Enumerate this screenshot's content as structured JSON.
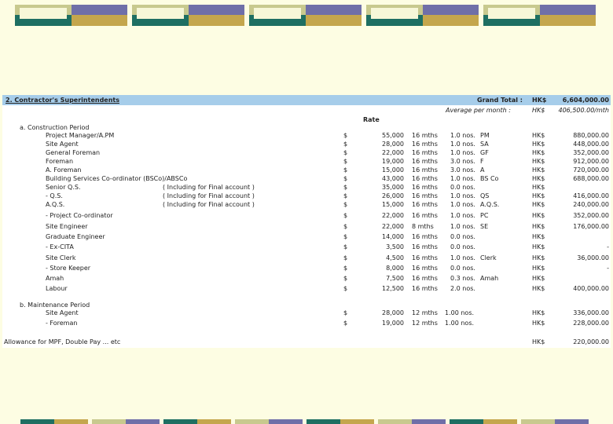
{
  "header_tiles": 5,
  "footer_bars": 8,
  "colors": {
    "tile_top_left": "#c8c98e",
    "tile_top_right": "#6f6fa8",
    "tile_bottom_left": "#1e6f62",
    "tile_bottom_right": "#c4a64d",
    "header_band": "#a6cdea",
    "page_bg": "#fdfde3"
  },
  "section": {
    "title": "2.  Contractor's Superintendents",
    "grand_total_label": "Grand Total :",
    "grand_total_currency": "HK$",
    "grand_total_value": "6,604,000.00",
    "avg_label": "Average per month :",
    "avg_currency": "HK$",
    "avg_value": "406,500.00/mth",
    "rate_header": "Rate"
  },
  "groups": {
    "construction": "a.  Construction Period",
    "maintenance": "b.  Maintenance Period"
  },
  "rows": [
    {
      "name": "Project Manager/A.PM",
      "note": "",
      "cur": "$",
      "rate": "55,000",
      "dur": "16 mths",
      "qty": "1.0 nos.",
      "code": "PM",
      "hk": "HK$",
      "amt": "880,000.00"
    },
    {
      "name": "Site Agent",
      "note": "",
      "cur": "$",
      "rate": "28,000",
      "dur": "16 mths",
      "qty": "1.0 nos.",
      "code": "SA",
      "hk": "HK$",
      "amt": "448,000.00"
    },
    {
      "name": "General Foreman",
      "note": "",
      "cur": "$",
      "rate": "22,000",
      "dur": "16 mths",
      "qty": "1.0 nos.",
      "code": "GF",
      "hk": "HK$",
      "amt": "352,000.00"
    },
    {
      "name": "Foreman",
      "note": "",
      "cur": "$",
      "rate": "19,000",
      "dur": "16 mths",
      "qty": "3.0 nos.",
      "code": "F",
      "hk": "HK$",
      "amt": "912,000.00"
    },
    {
      "name": "A. Foreman",
      "note": "",
      "cur": "$",
      "rate": "15,000",
      "dur": "16 mths",
      "qty": "3.0 nos.",
      "code": "A",
      "hk": "HK$",
      "amt": "720,000.00"
    },
    {
      "name": "Building Services Co-ordinator (BSCo)/ABSCo",
      "note": "",
      "cur": "$",
      "rate": "43,000",
      "dur": "16 mths",
      "qty": "1.0 nos.",
      "code": "BS Co",
      "hk": "HK$",
      "amt": "688,000.00"
    },
    {
      "name": "Senior Q.S.",
      "note": "( Including for Final account )",
      "cur": "$",
      "rate": "35,000",
      "dur": "16 mths",
      "qty": "0.0 nos.",
      "code": "",
      "hk": "HK$",
      "amt": ""
    },
    {
      "name": "- Q.S.",
      "note": "( Including for Final account )",
      "cur": "$",
      "rate": "26,000",
      "dur": "16 mths",
      "qty": "1.0 nos.",
      "code": "QS",
      "hk": "HK$",
      "amt": "416,000.00"
    },
    {
      "name": "A.Q.S.",
      "note": "( Including for Final account )",
      "cur": "$",
      "rate": "15,000",
      "dur": "16 mths",
      "qty": "1.0 nos.",
      "code": "A.Q.S.",
      "hk": "HK$",
      "amt": "240,000.00"
    },
    {
      "name": "- Project Co-ordinator",
      "note": "",
      "cur": "$",
      "rate": "22,000",
      "dur": "16 mths",
      "qty": "1.0 nos.",
      "code": "PC",
      "hk": "HK$",
      "amt": "352,000.00"
    },
    {
      "name": "Site Engineer",
      "note": "",
      "cur": "$",
      "rate": "22,000",
      "dur": "8 mths",
      "qty": "1.0 nos.",
      "code": "SE",
      "hk": "HK$",
      "amt": "176,000.00"
    },
    {
      "name": "Graduate Engineer",
      "note": "",
      "cur": "$",
      "rate": "14,000",
      "dur": "16 mths",
      "qty": "0.0 nos.",
      "code": "",
      "hk": "HK$",
      "amt": ""
    },
    {
      "name": "- Ex-CITA",
      "note": "",
      "cur": "$",
      "rate": "3,500",
      "dur": "16 mths",
      "qty": "0.0 nos.",
      "code": "",
      "hk": "HK$",
      "amt": "-"
    },
    {
      "name": "Site Clerk",
      "note": "",
      "cur": "$",
      "rate": "4,500",
      "dur": "16 mths",
      "qty": "1.0 nos.",
      "code": "Clerk",
      "hk": "HK$",
      "amt": "36,000.00"
    },
    {
      "name": "- Store Keeper",
      "note": "",
      "cur": "$",
      "rate": "8,000",
      "dur": "16 mths",
      "qty": "0.0 nos.",
      "code": "",
      "hk": "HK$",
      "amt": "-"
    },
    {
      "name": "Amah",
      "note": "",
      "cur": "$",
      "rate": "7,500",
      "dur": "16 mths",
      "qty": "0.3 nos.",
      "code": "Amah",
      "hk": "HK$",
      "amt": ""
    },
    {
      "name": "Labour",
      "note": "",
      "cur": "$",
      "rate": "12,500",
      "dur": "16 mths",
      "qty": "2.0 nos.",
      "code": "",
      "hk": "HK$",
      "amt": "400,000.00"
    }
  ],
  "maintenance_rows": [
    {
      "name": "Site Agent",
      "cur": "$",
      "rate": "28,000",
      "dur": "12 mths",
      "qty": "1.00 nos.",
      "hk": "HK$",
      "amt": "336,000.00"
    },
    {
      "name": "- Foreman",
      "cur": "$",
      "rate": "19,000",
      "dur": "12 mths",
      "qty": "1.00 nos.",
      "hk": "HK$",
      "amt": "228,000.00"
    }
  ],
  "allowance": {
    "label": "Allowance for MPF, Double Pay ... etc",
    "hk": "HK$",
    "amt": "220,000.00"
  }
}
